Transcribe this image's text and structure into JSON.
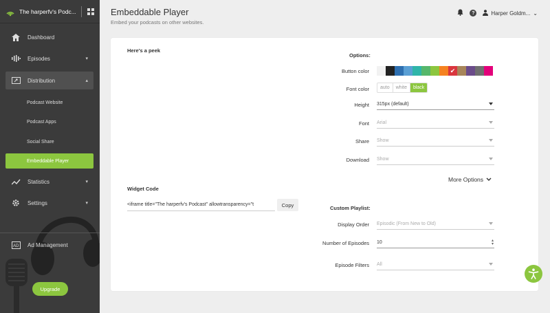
{
  "app": {
    "title": "The harperfv's Podc..."
  },
  "sidebar": {
    "items": [
      {
        "label": "Dashboard",
        "icon": "home-icon"
      },
      {
        "label": "Episodes",
        "icon": "waveform-icon"
      },
      {
        "label": "Distribution",
        "icon": "share-screen-icon"
      },
      {
        "label": "Statistics",
        "icon": "trend-icon"
      },
      {
        "label": "Settings",
        "icon": "gear-icon"
      },
      {
        "label": "Ad Management",
        "icon": "ad-icon"
      }
    ],
    "subitems": [
      {
        "label": "Podcast Website"
      },
      {
        "label": "Podcast Apps"
      },
      {
        "label": "Social Share"
      },
      {
        "label": "Embeddable Player"
      }
    ],
    "upgrade_label": "Upgrade"
  },
  "header": {
    "title": "Embeddable Player",
    "subtitle": "Embed your podcasts on other websites.",
    "user_name": "Harper Goldm..."
  },
  "preview": {
    "heading": "Here's a peek"
  },
  "options": {
    "heading": "Options:",
    "button_color_label": "Button color",
    "colors": [
      "#f2f2f2",
      "#222222",
      "#2e6fb0",
      "#5a9fd4",
      "#2fb5a9",
      "#56b76b",
      "#8cc63f",
      "#f58220",
      "#d9363e",
      "#a7855a",
      "#6b4c8a",
      "#6f6f6f",
      "#e3007a"
    ],
    "selected_color_index": 8,
    "font_color_label": "Font color",
    "font_color_options": [
      "auto",
      "white",
      "black"
    ],
    "font_color_selected": "black",
    "height_label": "Height",
    "height_value": "315px (default)",
    "font_label": "Font",
    "font_value": "Arial",
    "share_label": "Share",
    "share_value": "Show",
    "download_label": "Download",
    "download_value": "Show",
    "more_options_label": "More Options"
  },
  "widget": {
    "heading": "Widget Code",
    "code": "<iframe title=\"The harperfv's Podcast\" allowtransparency=\"t",
    "copy_label": "Copy"
  },
  "playlist": {
    "heading": "Custom Playlist:",
    "display_order_label": "Display Order",
    "display_order_value": "Episodic (From New to Old)",
    "num_episodes_label": "Number of Episodes",
    "num_episodes_value": "10",
    "episode_filters_label": "Episode Filters",
    "episode_filters_value": "All"
  }
}
